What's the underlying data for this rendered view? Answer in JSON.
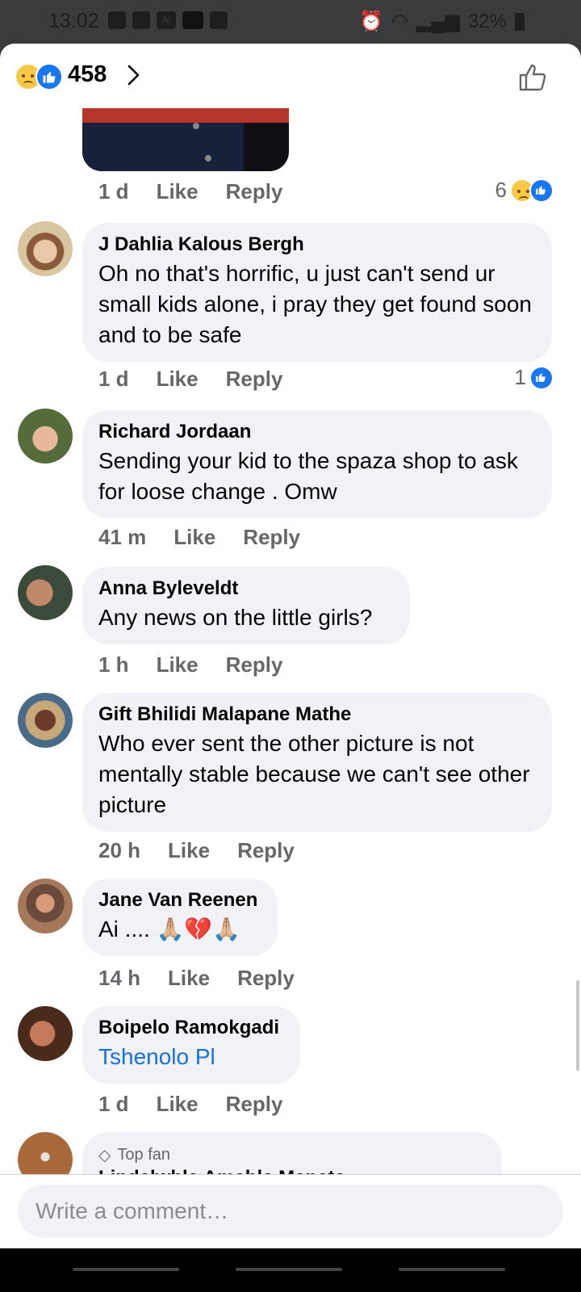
{
  "status": {
    "time": "13:02",
    "battery": "32%"
  },
  "header": {
    "reaction_count": "458"
  },
  "top_meta": {
    "time": "1 d",
    "like": "Like",
    "reply": "Reply",
    "reactions": "6"
  },
  "comments": [
    {
      "name": "J Dahlia Kalous Bergh",
      "text": "Oh no that's horrific, u just can't send ur small kids alone, i pray they get found soon and to be safe",
      "time": "1 d",
      "like": "Like",
      "reply": "Reply",
      "reactions": "1"
    },
    {
      "name": "Richard Jordaan",
      "text": "Sending your kid to the spaza shop to ask for loose change . Omw",
      "time": "41 m",
      "like": "Like",
      "reply": "Reply"
    },
    {
      "name": "Anna Byleveldt",
      "text": "Any news on the little girls?",
      "time": "1 h",
      "like": "Like",
      "reply": "Reply"
    },
    {
      "name": "Gift Bhilidi Malapane Mathe",
      "text": "Who ever sent the other picture is not mentally stable because we can't see other picture",
      "time": "20 h",
      "like": "Like",
      "reply": "Reply"
    },
    {
      "name": "Jane Van Reenen",
      "text": "Ai .... 🙏🏼💔🙏🏼",
      "time": "14 h",
      "like": "Like",
      "reply": "Reply"
    },
    {
      "name": "Boipelo Ramokgadi",
      "text": "Tshenolo Pl",
      "time": "1 d",
      "like": "Like",
      "reply": "Reply"
    }
  ],
  "partial_comment": {
    "badge": "Top fan",
    "name": "Lindelwhle Amahle Manete"
  },
  "composer": {
    "placeholder": "Write a comment…"
  },
  "colors": {
    "like_blue": "#1877f2",
    "bubble_bg": "#f0f2f5",
    "link": "#1a6fd8"
  }
}
